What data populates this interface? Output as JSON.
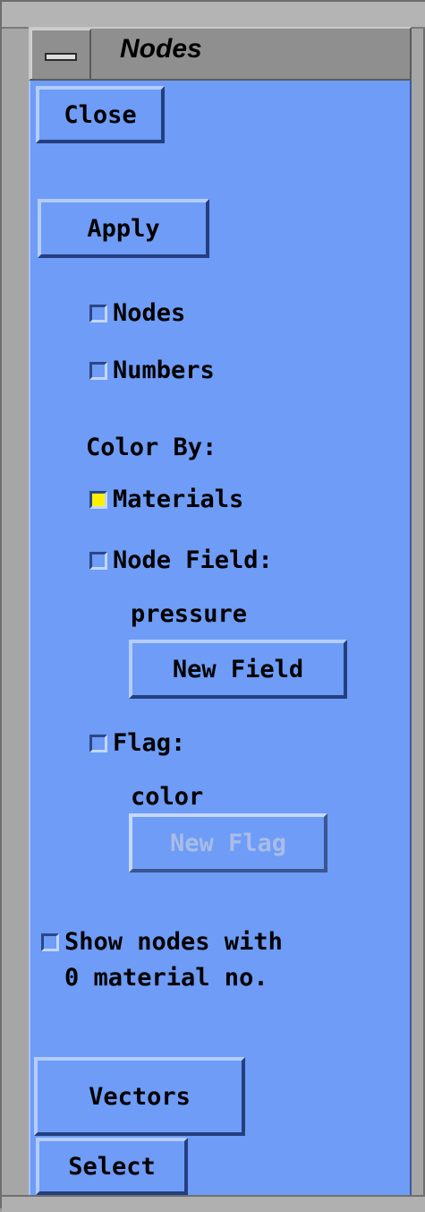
{
  "window": {
    "title": "Nodes"
  },
  "buttons": {
    "close": "Close",
    "apply": "Apply",
    "new_field": "New Field",
    "new_flag": "New Flag",
    "vectors": "Vectors",
    "select": "Select"
  },
  "toggles": {
    "nodes": {
      "label": "Nodes",
      "checked": false
    },
    "numbers": {
      "label": "Numbers",
      "checked": false
    },
    "materials": {
      "label": "Materials",
      "checked": true
    },
    "node_field": {
      "label": "Node Field:",
      "checked": false
    },
    "flag": {
      "label": "Flag:",
      "checked": false
    },
    "show_zero": {
      "label_line1": "Show nodes with",
      "label_line2": "0 material no.",
      "checked": false
    }
  },
  "labels": {
    "color_by": "Color By:",
    "field_value": "pressure",
    "flag_value": "color"
  },
  "colors": {
    "panel": "#6e9cf6",
    "selected_indicator": "#ffef00",
    "frame": "#a6a6a6"
  }
}
